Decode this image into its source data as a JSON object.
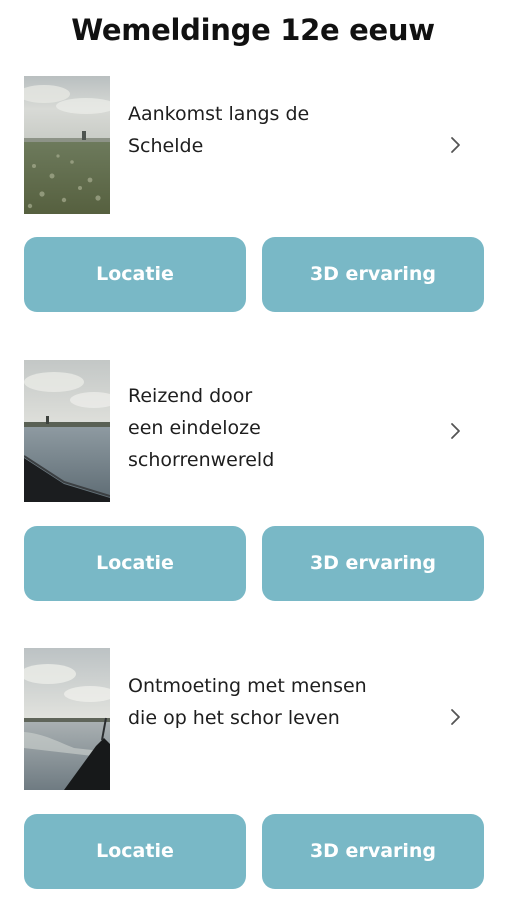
{
  "header": {
    "title": "Wemeldinge 12e eeuw"
  },
  "colors": {
    "button_bg": "#79b8c6",
    "button_text": "#ffffff",
    "text": "#1e1e1e"
  },
  "stops": [
    {
      "title": "Aankomst langs de\nSchelde",
      "thumbnail_icon": "field-landscape-photo",
      "location_label": "Locatie",
      "experience_label": "3D ervaring"
    },
    {
      "title": "Reizend door\neen eindeloze\nschorrenwereld",
      "thumbnail_icon": "water-boat-photo",
      "location_label": "Locatie",
      "experience_label": "3D ervaring"
    },
    {
      "title": "Ontmoeting met mensen\ndie op het schor leven",
      "thumbnail_icon": "tidal-flat-boat-photo",
      "location_label": "Locatie",
      "experience_label": "3D ervaring"
    }
  ],
  "icons": {
    "chevron": "chevron-right-icon"
  }
}
